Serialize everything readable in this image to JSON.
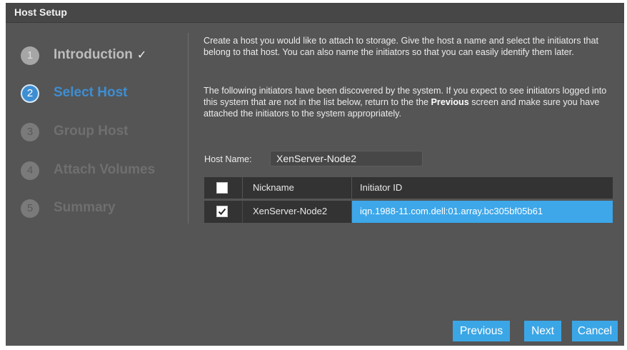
{
  "dialog": {
    "title": "Host Setup"
  },
  "steps": [
    {
      "number": "1",
      "label": "Introduction",
      "state": "done",
      "check": "✓"
    },
    {
      "number": "2",
      "label": "Select Host",
      "state": "current"
    },
    {
      "number": "3",
      "label": "Group Host",
      "state": "pending"
    },
    {
      "number": "4",
      "label": "Attach Volumes",
      "state": "pending"
    },
    {
      "number": "5",
      "label": "Summary",
      "state": "pending"
    }
  ],
  "content": {
    "intro": "Create a host you would like to attach to storage. Give the host a name and select the initiators that belong to that host. You can also name the initiators so that you can easily identify them later.",
    "discovered": {
      "before": "The following initiators have been discovered by the system. If you expect to see initiators logged into this system that are not in the list below, return to the the ",
      "bold": "Previous",
      "after": " screen and make sure you have attached the initiators to the system appropriately."
    },
    "host_name_label": "Host Name:",
    "host_name_value": "XenServer-Node2"
  },
  "table": {
    "columns": [
      "Nickname",
      "Initiator ID"
    ],
    "header_checked": false,
    "rows": [
      {
        "checked": true,
        "nickname": "XenServer-Node2",
        "initiator_id": "iqn.1988-11.com.dell:01.array.bc305bf05b61"
      }
    ]
  },
  "buttons": {
    "previous": "Previous",
    "next": "Next",
    "cancel": "Cancel"
  },
  "colors": {
    "accent": "#3da7e9",
    "current_step": "#3e8ed2",
    "dialog_bg": "#555555",
    "titlebar_bg": "#474747"
  }
}
